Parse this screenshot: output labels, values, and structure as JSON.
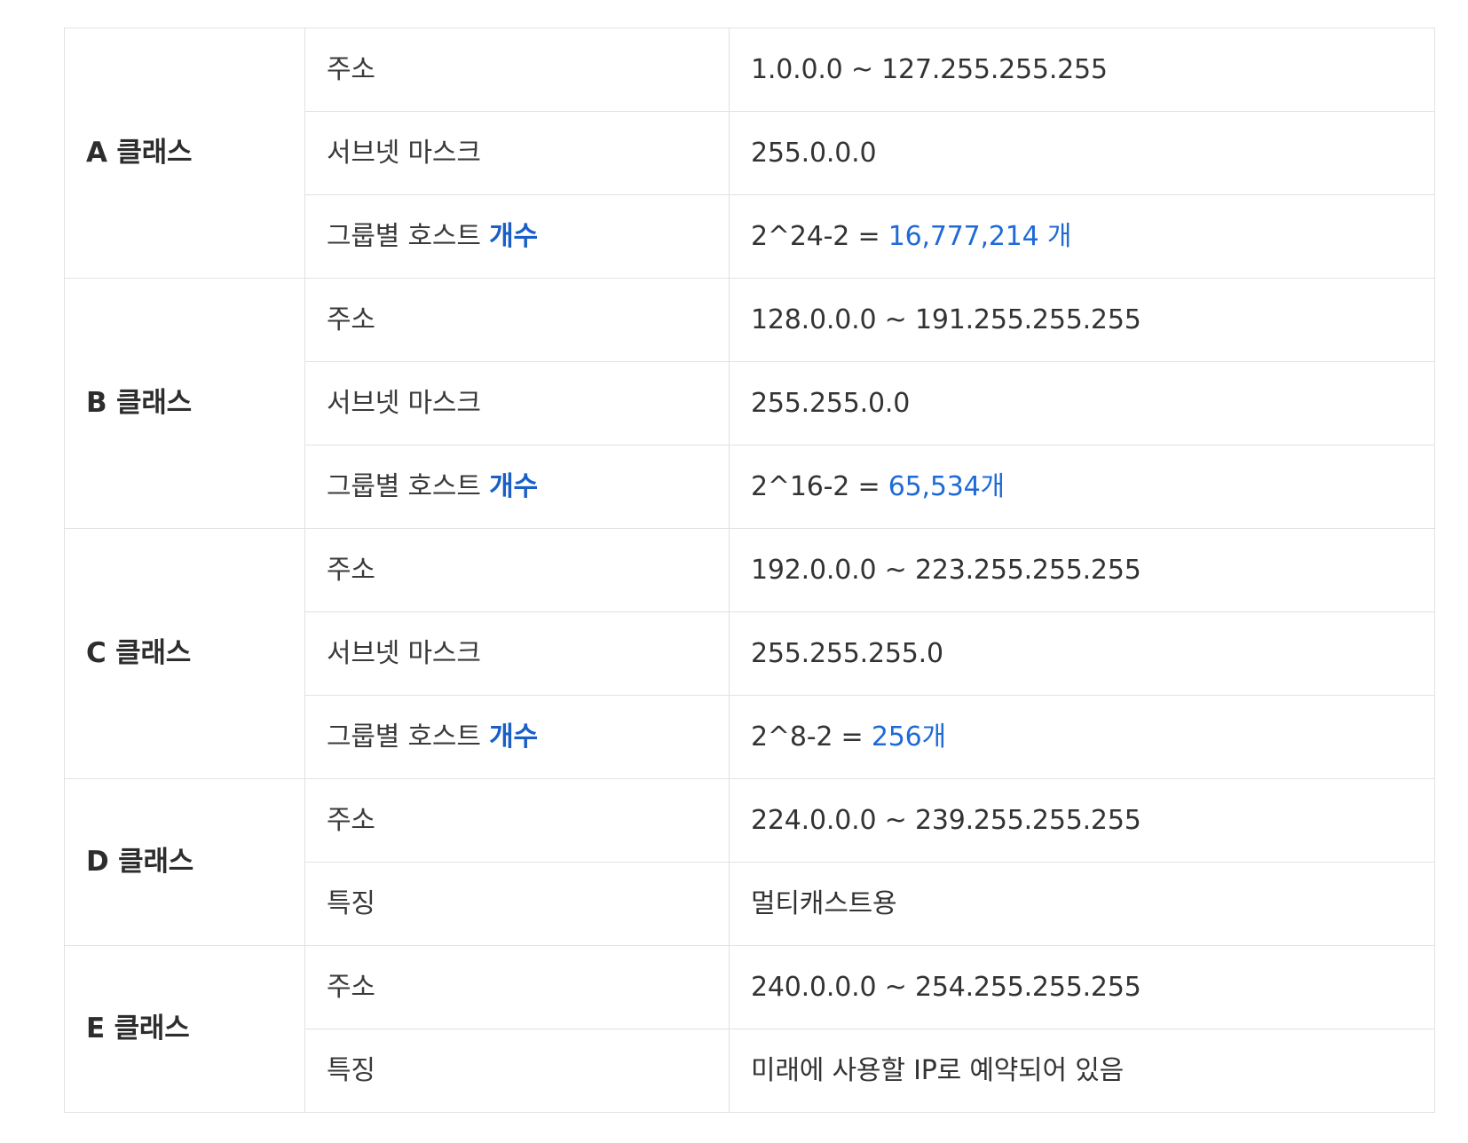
{
  "colors": {
    "accent": "#1e6ad6",
    "border": "#e2e2e2",
    "text": "#333333"
  },
  "classes": [
    {
      "name": "A 클래스",
      "rows": [
        {
          "label": "주소",
          "value": "1.0.0.0 ~ 127.255.255.255"
        },
        {
          "label": "서브넷 마스크",
          "value": "255.0.0.0"
        },
        {
          "label": "그룹별 호스트",
          "label_accent": "개수",
          "value": "2^24-2 = ",
          "value_accent": "16,777,214 개"
        }
      ]
    },
    {
      "name": "B 클래스",
      "rows": [
        {
          "label": "주소",
          "value": "128.0.0.0 ~ 191.255.255.255"
        },
        {
          "label": "서브넷 마스크",
          "value": "255.255.0.0"
        },
        {
          "label": "그룹별 호스트",
          "label_accent": "개수",
          "value": "2^16-2 = ",
          "value_accent": "65,534개"
        }
      ]
    },
    {
      "name": "C 클래스",
      "rows": [
        {
          "label": "주소",
          "value": "192.0.0.0 ~ 223.255.255.255"
        },
        {
          "label": "서브넷 마스크",
          "value": "255.255.255.0"
        },
        {
          "label": "그룹별 호스트",
          "label_accent": "개수",
          "value": "2^8-2 = ",
          "value_accent": "256개"
        }
      ]
    },
    {
      "name": "D 클래스",
      "rows": [
        {
          "label": "주소",
          "value": "224.0.0.0 ~ 239.255.255.255"
        },
        {
          "label": "특징",
          "value": "멀티캐스트용"
        }
      ]
    },
    {
      "name": "E 클래스",
      "rows": [
        {
          "label": "주소",
          "value": "240.0.0.0 ~ 254.255.255.255"
        },
        {
          "label": "특징",
          "value": "미래에 사용할 IP로 예약되어 있음"
        }
      ]
    }
  ]
}
